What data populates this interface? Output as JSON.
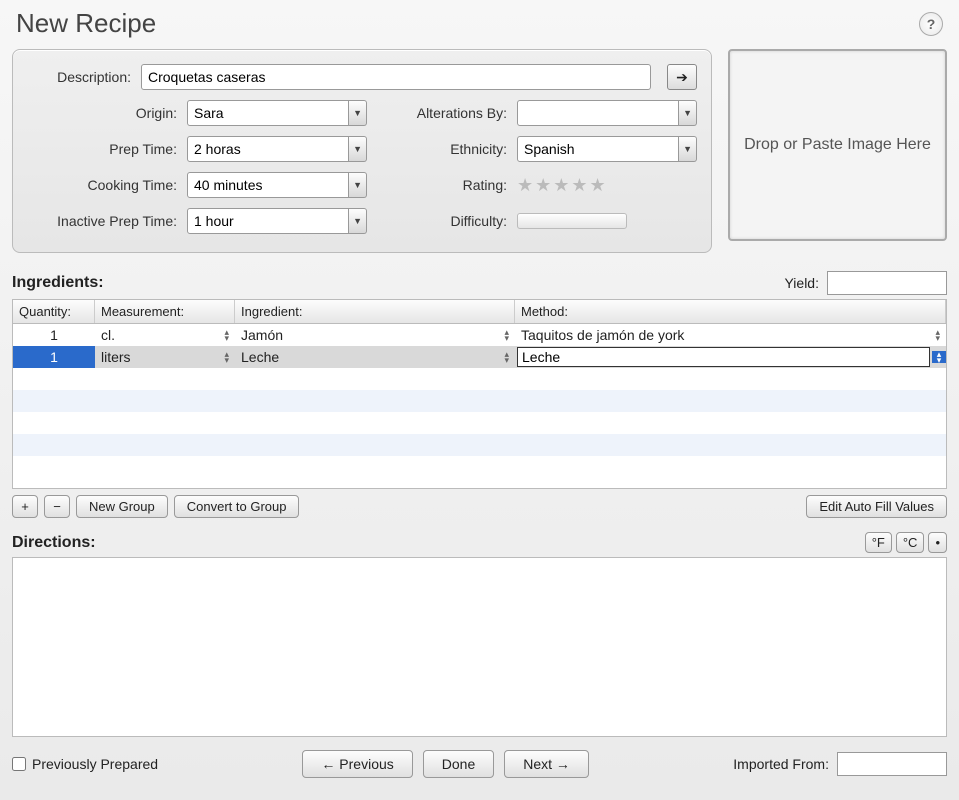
{
  "header": {
    "title": "New Recipe"
  },
  "labels": {
    "description": "Description:",
    "origin": "Origin:",
    "prep_time": "Prep Time:",
    "cooking_time": "Cooking Time:",
    "inactive_prep": "Inactive Prep Time:",
    "alterations": "Alterations By:",
    "ethnicity": "Ethnicity:",
    "rating": "Rating:",
    "difficulty": "Difficulty:",
    "yield": "Yield:",
    "ingredients": "Ingredients:",
    "directions": "Directions:",
    "imported_from": "Imported From:",
    "image_drop": "Drop or Paste Image Here",
    "previously_prepared": "Previously Prepared"
  },
  "values": {
    "description": "Croquetas caseras",
    "origin": "Sara",
    "prep_time": "2 horas",
    "cooking_time": "40 minutes",
    "inactive_prep": "1 hour",
    "alterations": "",
    "ethnicity": "Spanish",
    "yield": "",
    "directions": "",
    "imported_from": ""
  },
  "table": {
    "headers": {
      "quantity": "Quantity:",
      "measurement": "Measurement:",
      "ingredient": "Ingredient:",
      "method": "Method:"
    },
    "rows": [
      {
        "quantity": "1",
        "measurement": "cl.",
        "ingredient": "Jamón",
        "method": "Taquitos de jamón de york",
        "selected": false
      },
      {
        "quantity": "1",
        "measurement": "liters",
        "ingredient": "Leche",
        "method": "Leche",
        "selected": true
      }
    ]
  },
  "buttons": {
    "add": "+",
    "remove": "−",
    "new_group": "New Group",
    "convert": "Convert to Group",
    "edit_autofill": "Edit Auto Fill Values",
    "fahrenheit": "°F",
    "celsius": "°C",
    "bullet": "•",
    "previous": "←  Previous",
    "done": "Done",
    "next": "Next  →"
  },
  "stars": "★★★★★"
}
